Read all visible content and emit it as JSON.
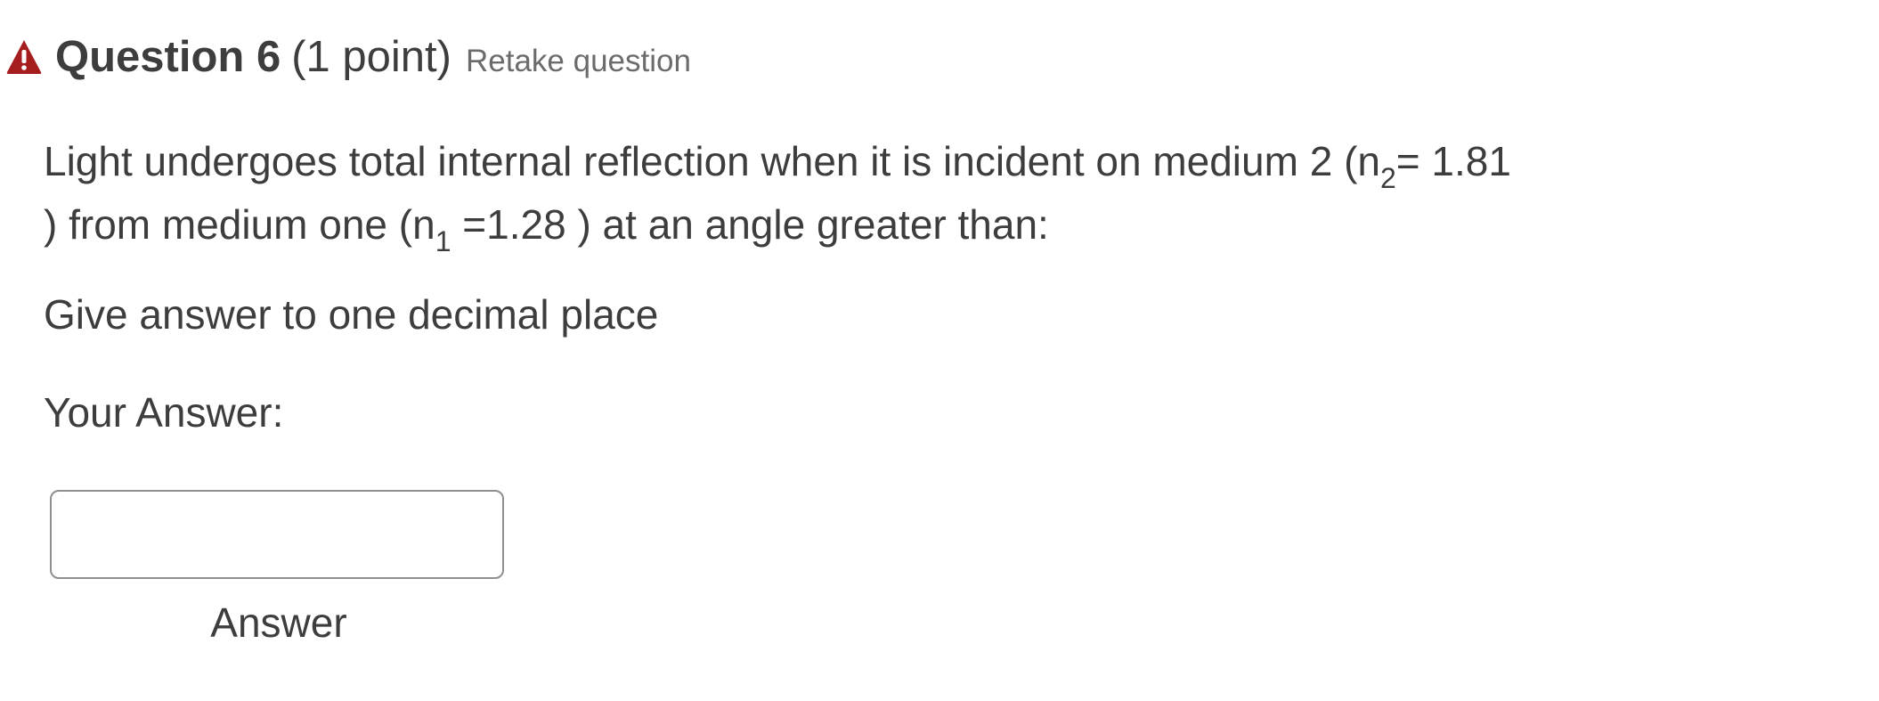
{
  "question": {
    "title": "Question 6",
    "points": "(1 point)",
    "retake_link": "Retake question",
    "status_icon": "warning-triangle-icon",
    "status_color": "#a61d1d",
    "text_line1_pre": "Light undergoes total internal reflection when it is incident on  medium 2  (n",
    "text_line1_sub": "2",
    "text_line1_post": "= 1.81",
    "text_line2_pre": ") from medium one (n",
    "text_line2_sub": "1",
    "text_line2_post": " =1.28 ) at an angle greater than:",
    "instruction": "Give answer to one decimal place"
  },
  "answer": {
    "prompt": "Your Answer:",
    "input_value": "",
    "caption": "Answer"
  }
}
